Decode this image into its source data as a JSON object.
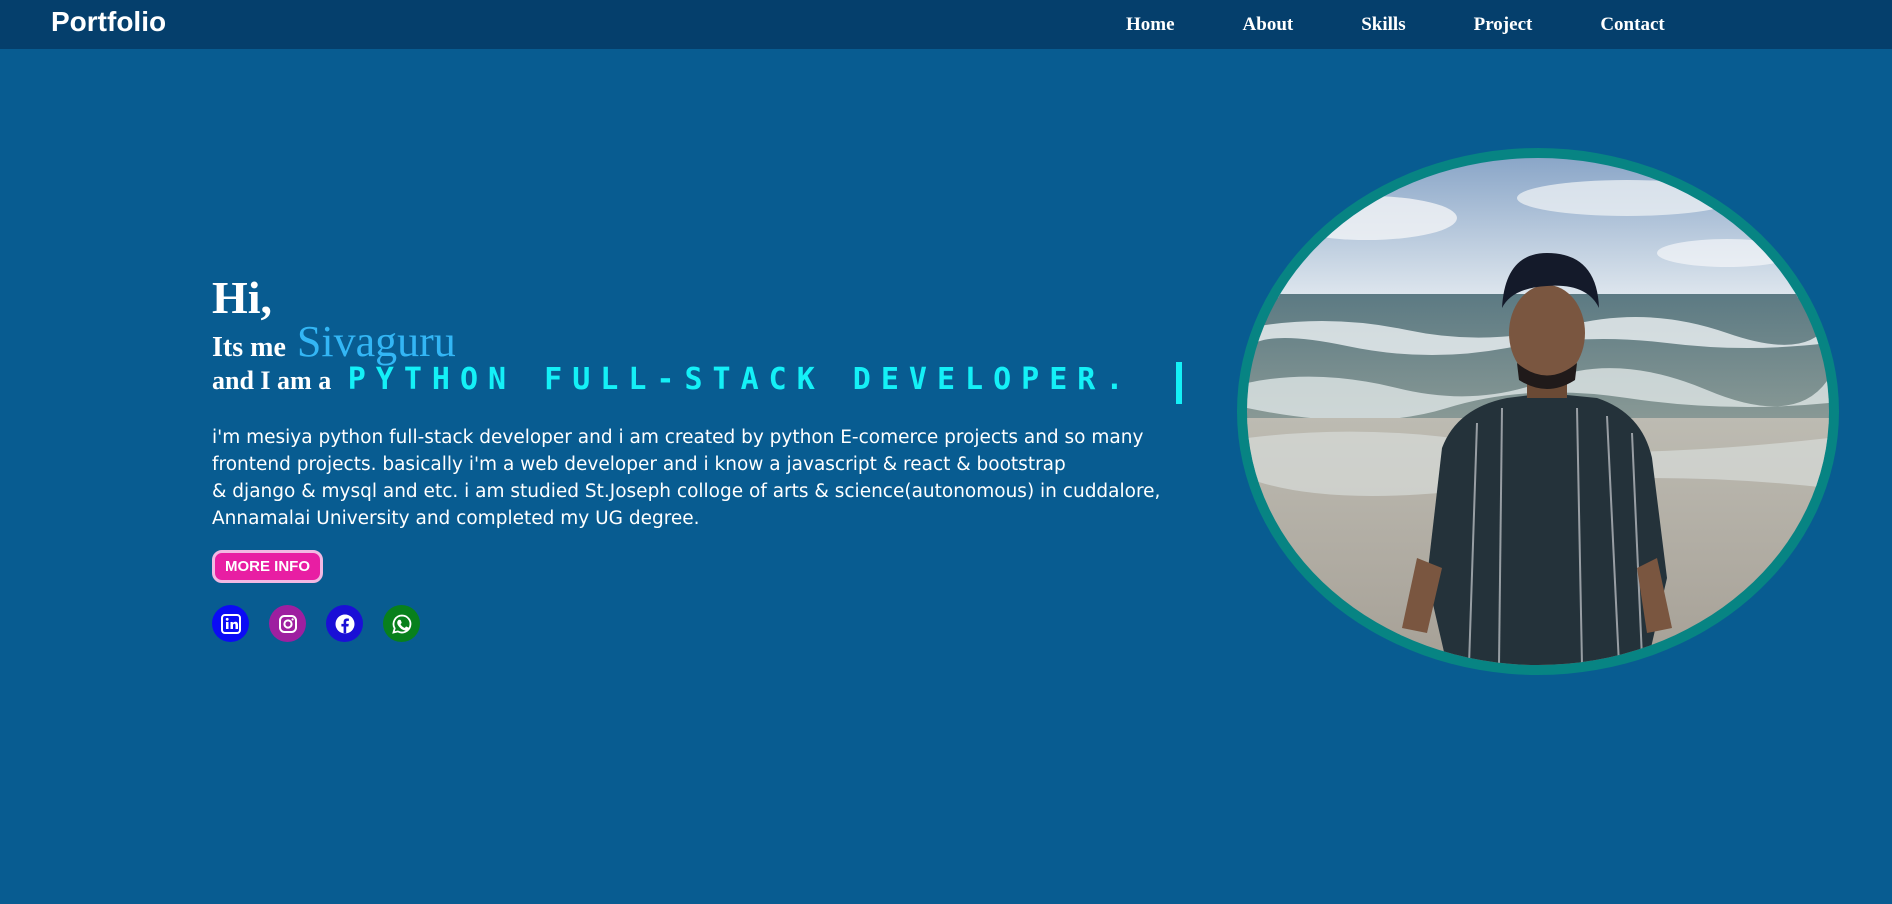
{
  "brand": "Portfolio",
  "nav": [
    "Home",
    "About",
    "Skills",
    "Project",
    "Contact"
  ],
  "hero": {
    "greeting": "Hi,",
    "intro": "Its me",
    "name": "Sivaguru",
    "and_label": "and I am a",
    "role": "PYTHON FULL-STACK DEVELOPER.",
    "description_lines": [
      "i'm mesiya python full-stack developer and i am created by python E-comerce projects and so many",
      "frontend projects. basically i'm a web developer and i know a javascript & react & bootstrap",
      "& django & mysql and etc. i am studied St.Joseph colloge of arts & science(autonomous) in cuddalore,",
      "Annamalai University and completed my UG degree."
    ],
    "button": "MORE INFO"
  },
  "socials": [
    {
      "name": "linkedin-icon",
      "color": "#0b0bf5"
    },
    {
      "name": "instagram-icon",
      "color": "#9e1fa0"
    },
    {
      "name": "facebook-icon",
      "color": "#1a0fd6"
    },
    {
      "name": "whatsapp-icon",
      "color": "#08801c"
    }
  ],
  "colors": {
    "background": "#085c91",
    "navbar": "#053f6c",
    "name": "#33b6f5",
    "role": "#14f0f7",
    "button": "#e81ea3",
    "photo_border": "#078483"
  }
}
